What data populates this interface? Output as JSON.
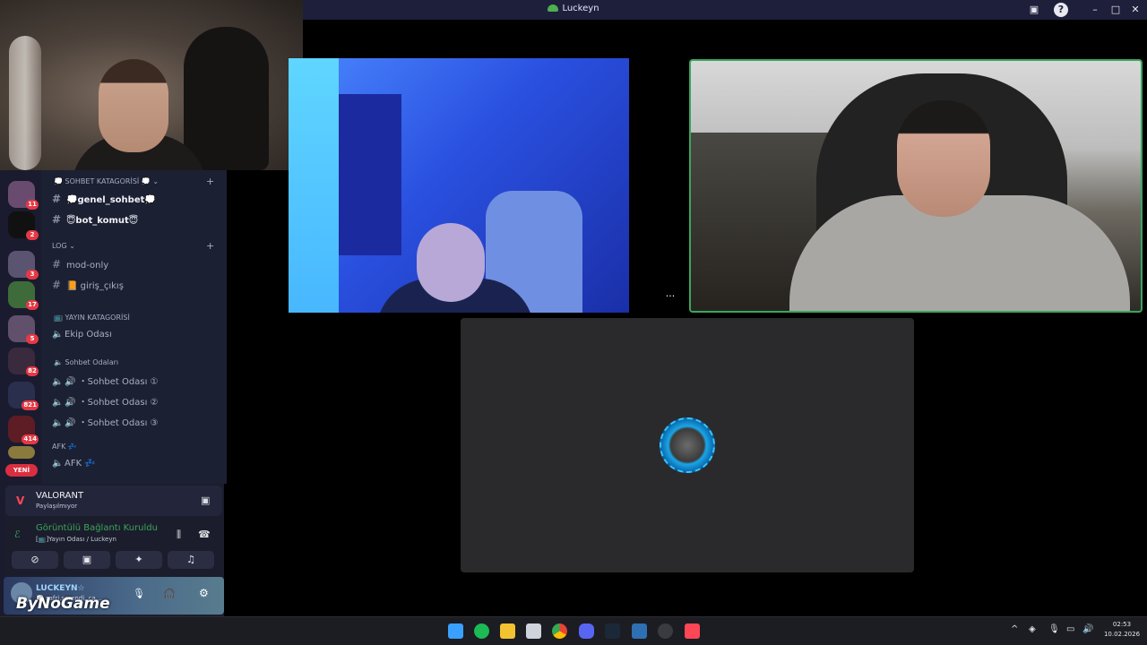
{
  "window": {
    "title": "Luckeyn"
  },
  "servers": {
    "badges": [
      "11",
      "2",
      "3",
      "17",
      "5",
      "82",
      "821",
      "414"
    ],
    "new_label": "YENİ"
  },
  "channels": {
    "categories": [
      {
        "name": "💭 SOHBET KATAGORİSİ 💭",
        "chevron": "⌄"
      },
      {
        "name": "LOG",
        "chevron": "⌄"
      },
      {
        "name": "📺 YAYIN KATAGORİSİ"
      },
      {
        "name": "🔈 Sohbet Odaları"
      },
      {
        "name": "AFK 💤"
      }
    ],
    "text_channels": [
      {
        "name": "💭genel_sohbet💭"
      },
      {
        "name": "😇bot_komut😇"
      },
      {
        "name": "mod-only"
      },
      {
        "name": "📙 giriş_çıkış"
      }
    ],
    "voice_channels": [
      {
        "name": "Ekip Odası"
      },
      {
        "name": "🔊 ・Sohbet Odası ①"
      },
      {
        "name": "🔊 ・Sohbet Odası ②"
      },
      {
        "name": "🔊 ・Sohbet Odası ③"
      },
      {
        "name": "AFK 💤"
      }
    ]
  },
  "activity": {
    "game": "VALORANT",
    "status": "Paylaşılmıyor"
  },
  "voice": {
    "connected_label": "Görüntülü Bağlantı Kuruldu",
    "location": "[📺]Yayın Odası / Luckeyn"
  },
  "user": {
    "name": "LUCKEYN☆",
    "status": "💭 safri,sarendi, ca..."
  },
  "watermark": "ByNoGame",
  "taskbar": {
    "time": "02:53",
    "date": "10.02.2026"
  },
  "colors": {
    "accent_green": "#3ba55d",
    "badge_red": "#e53945",
    "sidebar_bg": "#1c2033"
  }
}
